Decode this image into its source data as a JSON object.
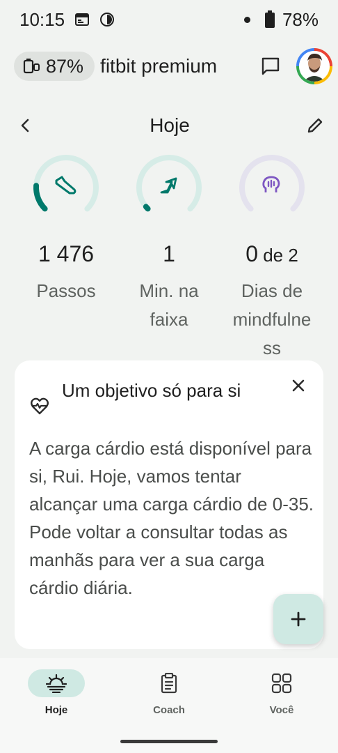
{
  "status_bar": {
    "time": "10:15",
    "battery_percent": "78%",
    "icons": [
      "calendar-icon",
      "browser-icon",
      "notification-dot",
      "battery-icon"
    ]
  },
  "header": {
    "device_battery": "87%",
    "brand": "fitbit premium",
    "icons": [
      "device-battery-icon",
      "chat-icon",
      "avatar"
    ]
  },
  "date_nav": {
    "title": "Hoje",
    "icons": [
      "back-chevron-icon",
      "edit-pencil-icon"
    ]
  },
  "rings": [
    {
      "value": "1 476",
      "suffix": "",
      "label_lines": [
        "Passos"
      ],
      "progress": 0.18,
      "icon": "shoe-icon",
      "color": "#00796b",
      "track": "#d6ece7"
    },
    {
      "value": "1",
      "suffix": "",
      "label_lines": [
        "Min. na",
        "faixa"
      ],
      "progress": 0.02,
      "icon": "zone-arrow-icon",
      "color": "#00796b",
      "track": "#d6ece7"
    },
    {
      "value": "0",
      "suffix": " de 2",
      "label_lines": [
        "Dias de",
        "mindfulne",
        "ss"
      ],
      "progress": 0.0,
      "icon": "mind-head-icon",
      "color": "#7e57c2",
      "track": "#e4e2ee"
    }
  ],
  "card": {
    "title": "Um objetivo só para si",
    "body": "A carga cárdio está disponível para si, Rui. Hoje, vamos tentar alcançar uma carga cárdio de 0-35. Pode voltar a consultar todas as manhãs para ver a sua carga cárdio diária.",
    "icons": [
      "heart-wave-icon",
      "close-icon"
    ]
  },
  "fab": {
    "label": "+"
  },
  "bottom_nav": [
    {
      "label": "Hoje",
      "active": true,
      "icon": "sunrise-icon"
    },
    {
      "label": "Coach",
      "active": false,
      "icon": "clipboard-icon"
    },
    {
      "label": "Você",
      "active": false,
      "icon": "grid-icon"
    }
  ],
  "colors": {
    "background": "#f1f3f1",
    "accent_teal": "#00796b",
    "accent_purple": "#7e57c2",
    "pill_bg": "#cfe9e3"
  }
}
